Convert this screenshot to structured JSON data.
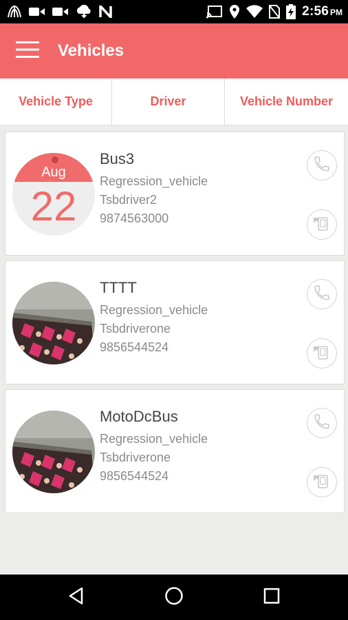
{
  "status_bar": {
    "time": "2:56",
    "ampm": "PM",
    "icons": [
      "stocks-icon",
      "video-icon",
      "video-icon",
      "cloud-download-icon",
      "n-icon",
      "cast-icon",
      "location-icon",
      "wifi-icon",
      "no-sim-icon",
      "battery-charging-icon"
    ]
  },
  "app_bar": {
    "title": "Vehicles",
    "menu_icon": "menu-icon",
    "background": "#f26868"
  },
  "sort_tabs": [
    {
      "label": "Vehicle Type"
    },
    {
      "label": "Driver"
    },
    {
      "label": "Vehicle Number"
    }
  ],
  "vehicles": [
    {
      "name": "Bus3",
      "type": "Regression_vehicle",
      "driver": "Tsbdriver2",
      "phone": "9874563000",
      "avatar": "calendar",
      "avatar_month": "Aug",
      "avatar_day": "22"
    },
    {
      "name": "TTTT",
      "type": "Regression_vehicle",
      "driver": "Tsbdriverone",
      "phone": "9856544524",
      "avatar": "photo"
    },
    {
      "name": "MotoDcBus",
      "type": "Regression_vehicle",
      "driver": "Tsbdriverone",
      "phone": "9856544524",
      "avatar": "photo"
    }
  ],
  "colors": {
    "accent": "#f26868",
    "tab_text": "#ef5b5b"
  }
}
